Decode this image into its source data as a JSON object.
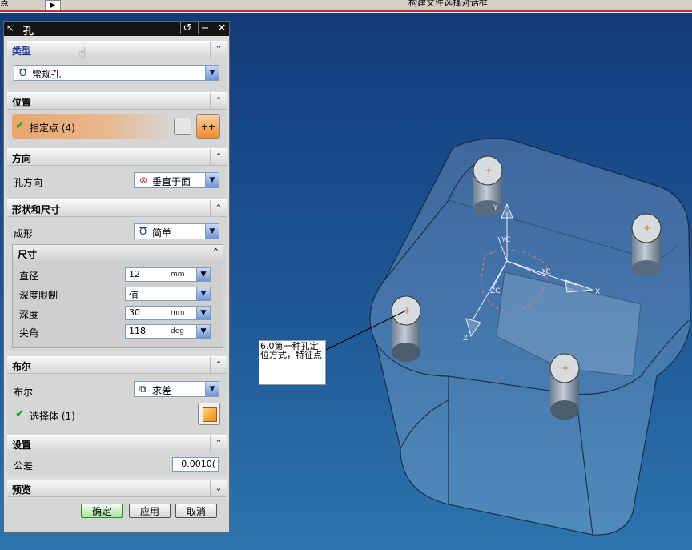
{
  "topbar": {
    "left_text": "点",
    "right_text": "构建文件选择对话框",
    "arrow": "▶"
  },
  "dialog": {
    "title": "孔",
    "title_buttons": {
      "reset": "↺",
      "minimize": "−",
      "close": "✕"
    },
    "type": {
      "header": "类型",
      "value": "常规孔"
    },
    "position": {
      "header": "位置",
      "specify_point": "指定点 (4)"
    },
    "direction": {
      "header": "方向",
      "label": "孔方向",
      "value": "垂直于面"
    },
    "shape": {
      "header": "形状和尺寸",
      "form_label": "成形",
      "form_value": "简单",
      "dims": {
        "header": "尺寸",
        "diameter": {
          "label": "直径",
          "value": "12",
          "unit": "mm"
        },
        "depth_limit": {
          "label": "深度限制",
          "value": "值"
        },
        "depth": {
          "label": "深度",
          "value": "30",
          "unit": "mm"
        },
        "tip_angle": {
          "label": "尖角",
          "value": "118",
          "unit": "deg"
        }
      }
    },
    "boolean": {
      "header": "布尔",
      "label": "布尔",
      "value": "求差",
      "select_body": "选择体 (1)"
    },
    "settings": {
      "header": "设置",
      "tolerance_label": "公差",
      "tolerance_value": "0.0010("
    },
    "preview": {
      "header": "预览"
    },
    "buttons": {
      "ok": "确定",
      "apply": "应用",
      "cancel": "取消"
    }
  },
  "viewport": {
    "annotation": "6.0第一种孔定位方式，特征点",
    "axes": {
      "x": "X",
      "y": "Y",
      "z": "Z",
      "xc": "XC",
      "yc": "YC",
      "zc": "ZC"
    }
  },
  "colors": {
    "background_top": "#123a78",
    "background_bottom": "#2d75ae",
    "title_bar": "#151515",
    "check": "#19a51c"
  }
}
